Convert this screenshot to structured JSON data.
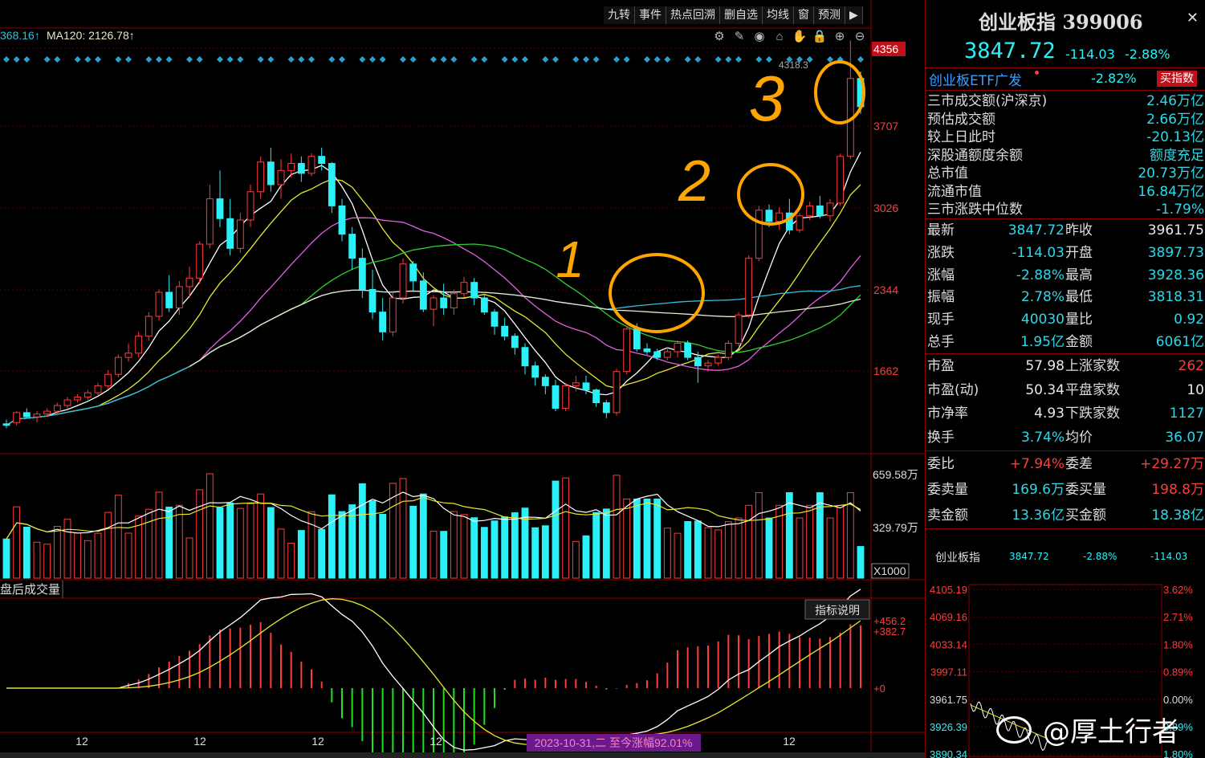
{
  "toolbar": {
    "tabs": [
      "九转",
      "事件",
      "热点回溯",
      "删自选",
      "均线",
      "窗",
      "预测"
    ],
    "ma_readout_1": "368.16↑",
    "ma_readout_2": "MA120: 2126.78↑"
  },
  "price_axis": {
    "labels": [
      "4356",
      "3707",
      "3026",
      "2344",
      "1662"
    ],
    "high_marker": "4318.3"
  },
  "volume_axis": {
    "labels": [
      "659.58万",
      "329.79万",
      "X1000"
    ]
  },
  "volume_title": "盘后成交量",
  "macd": {
    "button": "指标说明",
    "labels": [
      "+456.2",
      "+382.7",
      "+0"
    ]
  },
  "x_axis": {
    "labels": [
      "12",
      "12",
      "12",
      "12",
      "12"
    ],
    "highlight": "2023-10-31,二 至今涨幅92.01%"
  },
  "annotations": [
    "1",
    "2",
    "3"
  ],
  "panel": {
    "title": "创业板指 399006",
    "price": "3847.72",
    "change": "-114.03",
    "change_pct": "-2.88%",
    "etf_name": "创业板ETF广发",
    "etf_pct": "-2.82%",
    "buy_button": "买指数",
    "stats": [
      {
        "k": "三市成交额(沪深京)",
        "v": "2.46万亿",
        "c": "cy"
      },
      {
        "k": "预估成交额",
        "v": "2.66万亿",
        "c": "cy"
      },
      {
        "k": "较上日此时",
        "v": "-20.13亿",
        "c": "cy"
      },
      {
        "k": "深股通额度余额",
        "v": "额度充足",
        "c": "cy"
      },
      {
        "k": "总市值",
        "v": "20.73万亿",
        "c": "cy"
      },
      {
        "k": "流通市值",
        "v": "16.84万亿",
        "c": "cy"
      },
      {
        "k": "三市涨跌中位数",
        "v": "-1.79%",
        "c": "cy"
      }
    ],
    "quote": [
      {
        "k1": "最新",
        "v1": "3847.72",
        "c1": "cy",
        "k2": "昨收",
        "v2": "3961.75",
        "c2": "white"
      },
      {
        "k1": "涨跌",
        "v1": "-114.03",
        "c1": "cy",
        "k2": "开盘",
        "v2": "3897.73",
        "c2": "cy"
      },
      {
        "k1": "涨幅",
        "v1": "-2.88%",
        "c1": "cy",
        "k2": "最高",
        "v2": "3928.36",
        "c2": "cy"
      },
      {
        "k1": "振幅",
        "v1": "2.78%",
        "c1": "cy",
        "k2": "最低",
        "v2": "3818.31",
        "c2": "cy"
      },
      {
        "k1": "现手",
        "v1": "40030",
        "c1": "cy",
        "k2": "量比",
        "v2": "0.92",
        "c2": "cy"
      },
      {
        "k1": "总手",
        "v1": "1.95亿",
        "c1": "cy",
        "k2": "金额",
        "v2": "6061亿",
        "c2": "cy"
      }
    ],
    "breadth": [
      {
        "k1": "市盈",
        "v1": "57.98",
        "c1": "white",
        "k2": "上涨家数",
        "v2": "262",
        "c2": "red"
      },
      {
        "k1": "市盈(动)",
        "v1": "50.34",
        "c1": "white",
        "k2": "平盘家数",
        "v2": "10",
        "c2": "white"
      },
      {
        "k1": "市净率",
        "v1": "4.93",
        "c1": "white",
        "k2": "下跌家数",
        "v2": "1127",
        "c2": "cy"
      },
      {
        "k1": "换手",
        "v1": "3.74%",
        "c1": "cy",
        "k2": "均价",
        "v2": "36.07",
        "c2": "cy"
      }
    ],
    "orders": [
      {
        "k1": "委比",
        "v1": "+7.94%",
        "c1": "red",
        "k2": "委差",
        "v2": "+29.27万",
        "c2": "red"
      },
      {
        "k1": "委卖量",
        "v1": "169.6万",
        "c1": "cy",
        "k2": "委买量",
        "v2": "198.8万",
        "c2": "red"
      },
      {
        "k1": "卖金额",
        "v1": "13.36亿",
        "c1": "cy",
        "k2": "买金额",
        "v2": "18.38亿",
        "c2": "cy"
      }
    ],
    "mini": {
      "name": "创业板指",
      "price": "3847.72",
      "pct": "-2.88%",
      "chg": "-114.03",
      "left_labels": [
        "4105.19",
        "4069.16",
        "4033.14",
        "3997.11",
        "3961.75",
        "3926.39",
        "3890.34"
      ],
      "right_labels": [
        "3.62%",
        "2.71%",
        "1.80%",
        "0.89%",
        "0.00%",
        "0.89%",
        "1.80%"
      ]
    },
    "watermark": "@厚土行者"
  },
  "colors": {
    "up": "#ff3c3c",
    "down": "#2cf0f8",
    "ma5": "#ffffff",
    "ma10": "#e8e830",
    "ma20": "#e060e0",
    "ma30": "#30d030",
    "ma60": "#30c0e0",
    "ma120": "#e8e8c8",
    "annot": "#ffa500"
  },
  "chart_data": {
    "type": "candlestick",
    "ylim": [
      1400,
      4400
    ],
    "candles": [
      [
        1611,
        1640,
        1580,
        1600
      ],
      [
        1620,
        1700,
        1600,
        1690
      ],
      [
        1690,
        1720,
        1650,
        1660
      ],
      [
        1660,
        1700,
        1620,
        1680
      ],
      [
        1680,
        1720,
        1660,
        1700
      ],
      [
        1700,
        1760,
        1680,
        1740
      ],
      [
        1740,
        1800,
        1720,
        1780
      ],
      [
        1780,
        1820,
        1760,
        1800
      ],
      [
        1800,
        1850,
        1780,
        1830
      ],
      [
        1830,
        1900,
        1810,
        1880
      ],
      [
        1880,
        1990,
        1860,
        1960
      ],
      [
        1960,
        2100,
        1940,
        2080
      ],
      [
        2080,
        2180,
        2050,
        2110
      ],
      [
        2110,
        2260,
        2080,
        2230
      ],
      [
        2230,
        2400,
        2200,
        2370
      ],
      [
        2370,
        2560,
        2340,
        2540
      ],
      [
        2540,
        2660,
        2400,
        2430
      ],
      [
        2430,
        2620,
        2380,
        2580
      ],
      [
        2580,
        2720,
        2500,
        2640
      ],
      [
        2640,
        2900,
        2600,
        2880
      ],
      [
        2880,
        3300,
        2850,
        3200
      ],
      [
        3200,
        3400,
        3000,
        3060
      ],
      [
        3060,
        3200,
        2800,
        2850
      ],
      [
        2850,
        3100,
        2820,
        3050
      ],
      [
        3050,
        3300,
        3000,
        3250
      ],
      [
        3250,
        3500,
        3200,
        3460
      ],
      [
        3460,
        3560,
        3250,
        3300
      ],
      [
        3300,
        3480,
        3200,
        3400
      ],
      [
        3400,
        3520,
        3350,
        3450
      ],
      [
        3450,
        3500,
        3320,
        3380
      ],
      [
        3380,
        3520,
        3360,
        3500
      ],
      [
        3500,
        3560,
        3400,
        3450
      ],
      [
        3450,
        3460,
        3100,
        3150
      ],
      [
        3150,
        3200,
        2900,
        2950
      ],
      [
        2950,
        3000,
        2700,
        2780
      ],
      [
        2780,
        2850,
        2500,
        2560
      ],
      [
        2560,
        2700,
        2350,
        2400
      ],
      [
        2400,
        2500,
        2200,
        2260
      ],
      [
        2260,
        2550,
        2230,
        2500
      ],
      [
        2500,
        2780,
        2460,
        2740
      ],
      [
        2740,
        2760,
        2550,
        2620
      ],
      [
        2620,
        2680,
        2400,
        2420
      ],
      [
        2420,
        2520,
        2300,
        2500
      ],
      [
        2500,
        2600,
        2380,
        2430
      ],
      [
        2430,
        2560,
        2380,
        2530
      ],
      [
        2530,
        2650,
        2500,
        2610
      ],
      [
        2610,
        2640,
        2450,
        2500
      ],
      [
        2500,
        2520,
        2380,
        2400
      ],
      [
        2400,
        2420,
        2240,
        2300
      ],
      [
        2300,
        2360,
        2200,
        2230
      ],
      [
        2230,
        2250,
        2100,
        2150
      ],
      [
        2150,
        2180,
        1960,
        2020
      ],
      [
        2020,
        2050,
        1880,
        1940
      ],
      [
        1940,
        1960,
        1820,
        1880
      ],
      [
        1880,
        1920,
        1700,
        1720
      ],
      [
        1720,
        1900,
        1700,
        1880
      ],
      [
        1880,
        1950,
        1840,
        1900
      ],
      [
        1900,
        1950,
        1820,
        1850
      ],
      [
        1850,
        1860,
        1730,
        1760
      ],
      [
        1760,
        1780,
        1650,
        1690
      ],
      [
        1690,
        2000,
        1670,
        1980
      ],
      [
        1980,
        2300,
        1960,
        2280
      ],
      [
        2280,
        2320,
        2120,
        2140
      ],
      [
        2140,
        2180,
        2100,
        2120
      ],
      [
        2120,
        2140,
        2060,
        2080
      ],
      [
        2080,
        2150,
        2060,
        2120
      ],
      [
        2120,
        2200,
        2080,
        2180
      ],
      [
        2180,
        2200,
        2060,
        2080
      ],
      [
        2080,
        2120,
        1900,
        2020
      ],
      [
        2020,
        2060,
        1980,
        2040
      ],
      [
        2040,
        2100,
        2020,
        2080
      ],
      [
        2080,
        2200,
        2060,
        2180
      ],
      [
        2180,
        2400,
        2160,
        2380
      ],
      [
        2380,
        2800,
        2360,
        2780
      ],
      [
        2780,
        3150,
        2760,
        3120
      ],
      [
        3120,
        3160,
        3000,
        3040
      ],
      [
        3040,
        3140,
        2980,
        3100
      ],
      [
        3100,
        3200,
        2950,
        2980
      ],
      [
        2980,
        3100,
        2960,
        3080
      ],
      [
        3080,
        3180,
        3050,
        3150
      ],
      [
        3150,
        3220,
        3060,
        3080
      ],
      [
        3080,
        3200,
        3040,
        3170
      ],
      [
        3170,
        3520,
        3150,
        3500
      ],
      [
        3500,
        4318,
        3480,
        4050
      ],
      [
        4050,
        4100,
        3800,
        3850
      ]
    ],
    "volume_max": 659.58,
    "macd_labels": [
      "+456.2",
      "+382.7",
      "+0"
    ]
  }
}
